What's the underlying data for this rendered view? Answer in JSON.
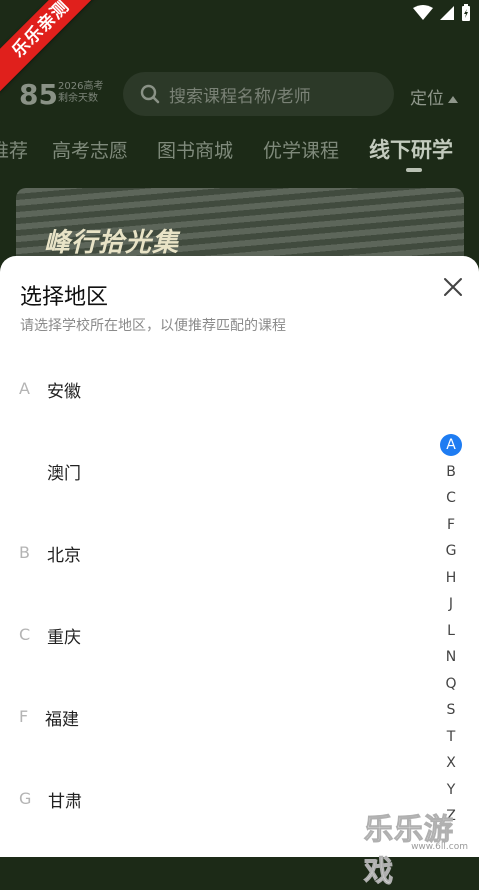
{
  "watermark_corner": "乐乐亲测",
  "header": {
    "days_count": "85",
    "days_label_line1": "2026高考",
    "days_label_line2": "剩余天数",
    "search_placeholder": "搜索课程名称/老师",
    "locate_label": "定位"
  },
  "tabs": [
    {
      "label": "推荐"
    },
    {
      "label": "高考志愿"
    },
    {
      "label": "图书商城"
    },
    {
      "label": "优学课程"
    },
    {
      "label": "线下研学"
    }
  ],
  "banner": {
    "title": "峰行拾光集"
  },
  "sheet": {
    "title": "选择地区",
    "subtitle": "请选择学校所在地区，以便推荐匹配的课程",
    "regions": [
      {
        "letter": "A",
        "name": "安徽"
      },
      {
        "letter": "",
        "name": "澳门"
      },
      {
        "letter": "B",
        "name": "北京"
      },
      {
        "letter": "C",
        "name": "重庆"
      },
      {
        "letter": "F",
        "name": "福建"
      },
      {
        "letter": "G",
        "name": "甘肃"
      }
    ],
    "index_letters": [
      "A",
      "B",
      "C",
      "F",
      "G",
      "H",
      "J",
      "L",
      "N",
      "Q",
      "S",
      "T",
      "X",
      "Y",
      "Z"
    ],
    "active_index": "A"
  },
  "site_watermark": {
    "text": "乐乐游戏",
    "url": "www.6ll.com"
  },
  "colors": {
    "accent": "#1e7cf2",
    "ribbon": "#e0201c"
  }
}
